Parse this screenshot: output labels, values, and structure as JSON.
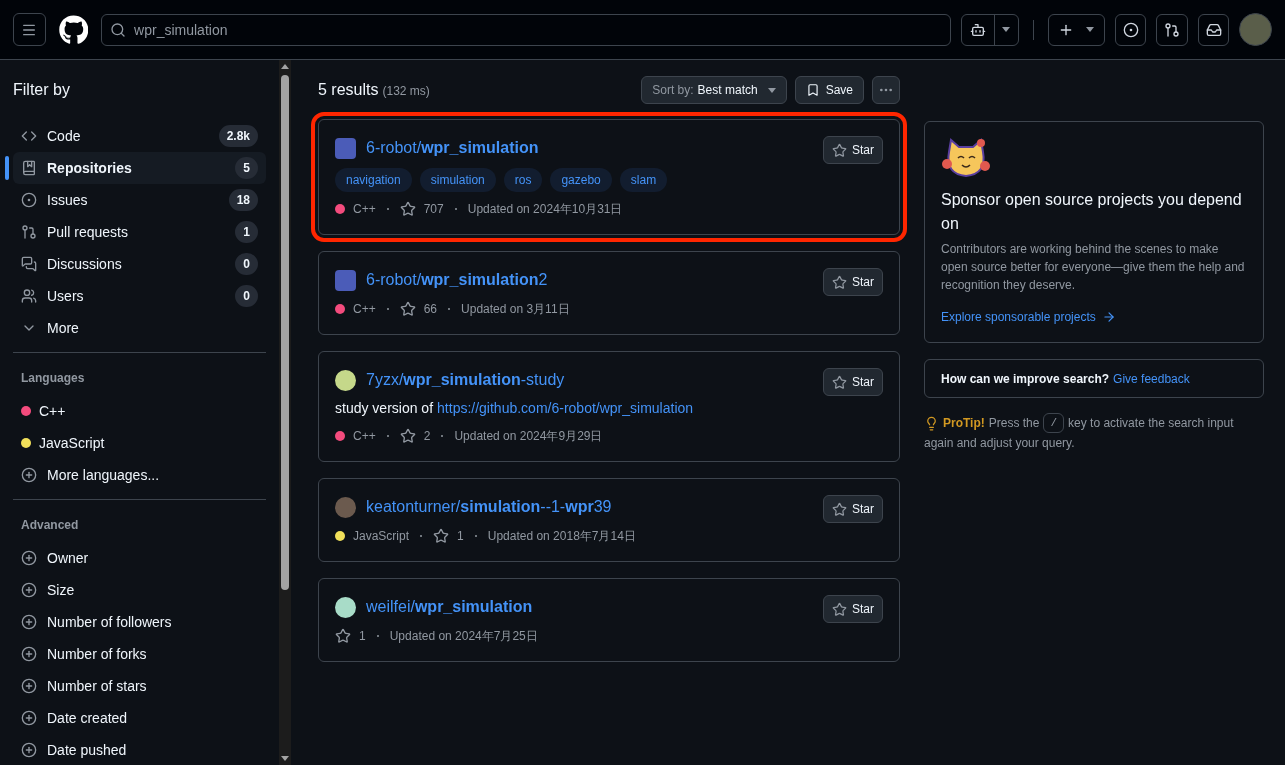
{
  "header": {
    "search": {
      "value": "wpr_simulation"
    }
  },
  "sidebar": {
    "title": "Filter by",
    "types": [
      {
        "label": "Code",
        "count": "2.8k",
        "selected": false
      },
      {
        "label": "Repositories",
        "count": "5",
        "selected": true
      },
      {
        "label": "Issues",
        "count": "18",
        "selected": false
      },
      {
        "label": "Pull requests",
        "count": "1",
        "selected": false
      },
      {
        "label": "Discussions",
        "count": "0",
        "selected": false
      },
      {
        "label": "Users",
        "count": "0",
        "selected": false
      }
    ],
    "more": "More",
    "languages_heading": "Languages",
    "languages": [
      {
        "name": "C++",
        "color": "#f34b7d"
      },
      {
        "name": "JavaScript",
        "color": "#f1e05a"
      }
    ],
    "more_languages": "More languages...",
    "advanced_heading": "Advanced",
    "advanced": [
      "Owner",
      "Size",
      "Number of followers",
      "Number of forks",
      "Number of stars",
      "Date created",
      "Date pushed"
    ]
  },
  "results": {
    "count": "5 results",
    "time": "(132 ms)",
    "sort_label": "Sort by:",
    "sort_value": "Best match",
    "save": "Save",
    "items": [
      {
        "name": "6-robot/**wpr_simulation**",
        "highlighted": true,
        "topics": [
          "navigation",
          "simulation",
          "ros",
          "gazebo",
          "slam"
        ],
        "language": {
          "name": "C++",
          "color": "#f34b7d"
        },
        "star_count": "707",
        "updated": "Updated on 2024年10月31日",
        "star_button": "Star"
      },
      {
        "name": "6-robot/**wpr_simulation**2",
        "highlighted": false,
        "language": {
          "name": "C++",
          "color": "#f34b7d"
        },
        "star_count": "66",
        "updated": "Updated on 3月11日",
        "star_button": "Star"
      },
      {
        "name": "7yzx/**wpr_simulation**-study",
        "highlighted": false,
        "description": {
          "text": "study version of",
          "link": "https://github.com/6-robot/wpr_simulation"
        },
        "language": {
          "name": "C++",
          "color": "#f34b7d"
        },
        "star_count": "2",
        "updated": "Updated on 2024年9月29日",
        "star_button": "Star"
      },
      {
        "name": "keatonturner/**simulation**--1-**wpr**39",
        "highlighted": false,
        "language": {
          "name": "JavaScript",
          "color": "#f1e05a"
        },
        "star_count": "1",
        "updated": "Updated on 2018年7月14日",
        "star_button": "Star"
      },
      {
        "name": "weilfei/**wpr_simulation**",
        "highlighted": false,
        "star_count": "1",
        "updated": "Updated on 2024年7月25日",
        "star_button": "Star"
      }
    ]
  },
  "sponsor": {
    "title": "Sponsor open source projects you depend on",
    "text": "Contributors are working behind the scenes to make open source better for everyone—give them the help and recognition they deserve.",
    "link": "Explore sponsorable projects"
  },
  "feedback": {
    "question": "How can we improve search?",
    "link": "Give feedback"
  },
  "protip": {
    "label": "ProTip!",
    "before": "Press the",
    "key": "/",
    "after": "key to activate the search input",
    "continuation": "again and adjust your query."
  }
}
